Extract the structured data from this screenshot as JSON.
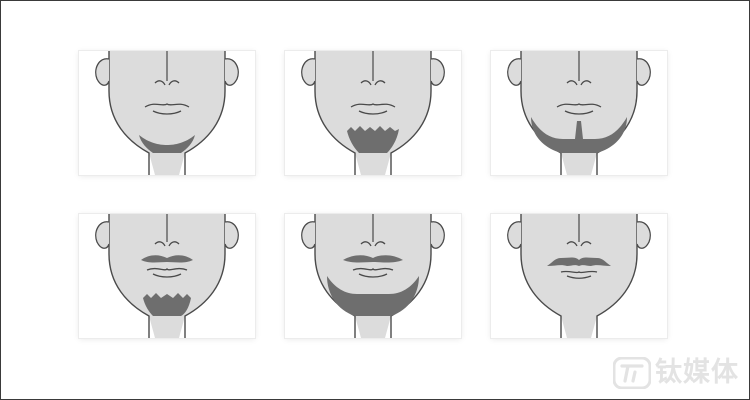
{
  "figure": {
    "panels": [
      {
        "id": "1",
        "beard": "chin-strap-short",
        "mustache": "none"
      },
      {
        "id": "2",
        "beard": "stubble-chin",
        "mustache": "none"
      },
      {
        "id": "3",
        "beard": "jaw-beard-with-soul-patch",
        "mustache": "none"
      },
      {
        "id": "4",
        "beard": "chin-stubble",
        "mustache": "thick-short"
      },
      {
        "id": "5",
        "beard": "full-jaw-beard",
        "mustache": "thick-wide"
      },
      {
        "id": "6",
        "beard": "none",
        "mustache": "handlebar"
      }
    ],
    "colors": {
      "skin": "#dcdcdc",
      "line": "#4a4a4a",
      "hair": "#6e6e6e",
      "watermark": "#e3e3e3"
    }
  },
  "watermark": {
    "text": "钛媒体",
    "icon": "tmt-logo-icon"
  }
}
